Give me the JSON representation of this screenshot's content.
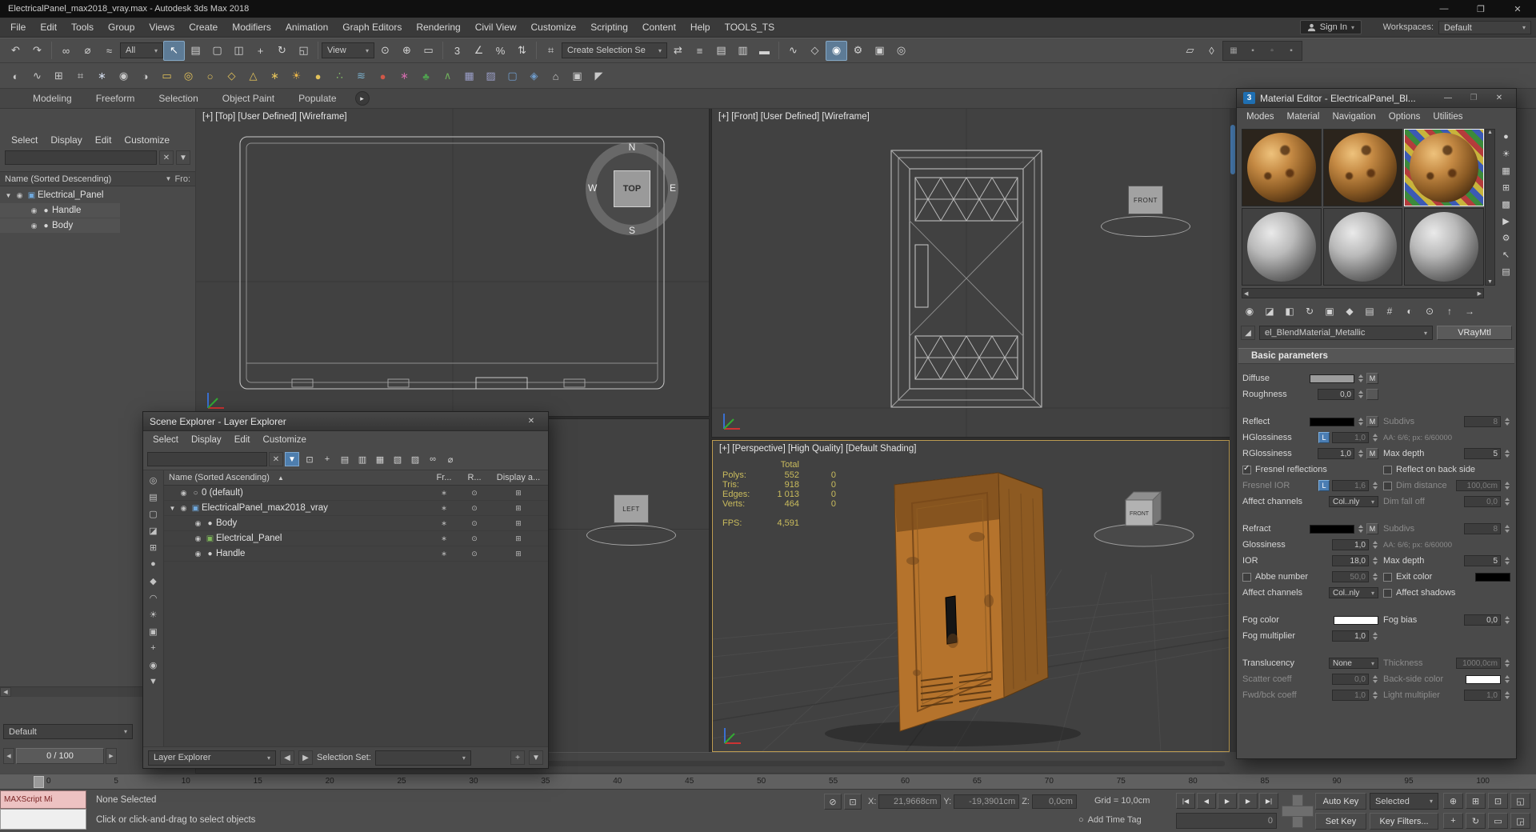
{
  "glyphs": {
    "minimize": "—",
    "maximize": "❐",
    "close": "✕",
    "clear": "✕",
    "funnel": "▼",
    "sort_asc": "▲",
    "left_arrow": "◀",
    "right_arrow": "▶",
    "up_arrow": "▲",
    "down_arrow": "▼",
    "app3": "3",
    "dropper": "◢",
    "ribbon_play": "▸",
    "play_start": "|◀",
    "play_prev": "◀",
    "play": "▶",
    "play_next": "▶",
    "play_end": "▶|",
    "isolate": "⊘",
    "lock": "⊡",
    "clock": "○"
  },
  "titlebar": {
    "title": "ElectricalPanel_max2018_vray.max - Autodesk 3ds Max 2018"
  },
  "menubar": {
    "items": [
      "File",
      "Edit",
      "Tools",
      "Group",
      "Views",
      "Create",
      "Modifiers",
      "Animation",
      "Graph Editors",
      "Rendering",
      "Civil View",
      "Customize",
      "Scripting",
      "Content",
      "Help",
      "TOOLS_TS"
    ],
    "sign_in": "Sign In",
    "workspaces_label": "Workspaces:",
    "workspace_value": "Default"
  },
  "toolbars": {
    "filter_value": "All",
    "ref_value": "View",
    "named_value": "Create Selection Se",
    "row1a": [
      {
        "name": "undo-icon",
        "glyph": "↶"
      },
      {
        "name": "redo-icon",
        "glyph": "↷"
      }
    ],
    "row1b": [
      {
        "name": "select-and-link-icon",
        "glyph": "∞"
      },
      {
        "name": "unlink-selection-icon",
        "glyph": "⌀"
      },
      {
        "name": "bind-to-space-warp-icon",
        "glyph": "≈"
      }
    ],
    "row1c": [
      {
        "name": "select-object-icon",
        "glyph": "↖",
        "cls": "active"
      },
      {
        "name": "select-by-name-icon",
        "glyph": "▤"
      },
      {
        "name": "rectangular-selection-region-icon",
        "glyph": "▢"
      },
      {
        "name": "window-crossing-icon",
        "glyph": "◫"
      }
    ],
    "row1d": [
      {
        "name": "select-and-move-icon",
        "glyph": "+"
      },
      {
        "name": "select-and-rotate-icon",
        "glyph": "↻"
      },
      {
        "name": "select-and-scale-icon",
        "glyph": "◱"
      }
    ],
    "row1e": [
      {
        "name": "use-pivot-point-icon",
        "glyph": "⊙"
      },
      {
        "name": "select-and-manipulate-icon",
        "glyph": "⊕"
      },
      {
        "name": "keyboard-shortcut-override-icon",
        "glyph": "▭"
      }
    ],
    "row1f": [
      {
        "name": "snaps-toggle-icon",
        "glyph": "3"
      },
      {
        "name": "angle-snap-icon",
        "glyph": "∠"
      },
      {
        "name": "percent-snap-icon",
        "glyph": "%"
      },
      {
        "name": "spinner-snap-icon",
        "glyph": "⇅"
      }
    ],
    "row1g": [
      {
        "name": "edit-named-selection-sets-icon",
        "glyph": "⌗"
      }
    ],
    "row1h": [
      {
        "name": "mirror-icon",
        "glyph": "⇄"
      },
      {
        "name": "align-icon",
        "glyph": "≡"
      },
      {
        "name": "toggle-scene-explorer-icon",
        "glyph": "▤"
      },
      {
        "name": "toggle-layer-explorer-icon",
        "glyph": "▥"
      },
      {
        "name": "toggle-ribbon-icon",
        "glyph": "▬"
      }
    ],
    "row1i": [
      {
        "name": "curve-editor-icon",
        "glyph": "∿"
      },
      {
        "name": "schematic-view-icon",
        "glyph": "◇"
      },
      {
        "name": "material-editor-icon",
        "glyph": "◉",
        "cls": "active"
      },
      {
        "name": "render-setup-icon",
        "glyph": "⚙"
      },
      {
        "name": "rendered-frame-window-icon",
        "glyph": "▣"
      },
      {
        "name": "render-production-icon",
        "glyph": "◎"
      }
    ],
    "row1_tail": [
      {
        "name": "project-folder-icon",
        "glyph": "▱"
      },
      {
        "name": "asset-tracking-icon",
        "glyph": "◊"
      }
    ],
    "row1_dark": [
      {
        "name": "viewport-layout-icon",
        "glyph": "▦"
      },
      {
        "name": "docking-left-icon",
        "glyph": "▪"
      },
      {
        "name": "docking-right-icon",
        "glyph": "▫"
      },
      {
        "name": "mini-listener-icon",
        "glyph": "▪"
      }
    ],
    "row2": [
      {
        "name": "freeform-paint-icon",
        "glyph": "◐",
        "color": "#c9c9c9"
      },
      {
        "name": "smudge-brush-icon",
        "glyph": "∿",
        "color": "#c9c9c9"
      },
      {
        "name": "grid-helper-icon",
        "glyph": "⊞",
        "color": "#c9c9c9"
      },
      {
        "name": "data-table-icon",
        "glyph": "⌗",
        "color": "#c9c9c9"
      },
      {
        "name": "snowflake-icon",
        "glyph": "∗",
        "color": "#cfd8e8"
      },
      {
        "name": "paint-deform-icon",
        "glyph": "◉",
        "color": "#c9c9c9"
      },
      {
        "name": "mirror-brush-icon",
        "glyph": "◑",
        "color": "#c9c9c9"
      },
      {
        "name": "rectangle-shape-icon",
        "glyph": "▭",
        "color": "#e3c25a"
      },
      {
        "name": "donut-shape-icon",
        "glyph": "◎",
        "color": "#e3c25a"
      },
      {
        "name": "circle-shape-icon",
        "glyph": "○",
        "color": "#e3c25a"
      },
      {
        "name": "ngon-shape-icon",
        "glyph": "◇",
        "color": "#e3c25a"
      },
      {
        "name": "cone-primitive-icon",
        "glyph": "△",
        "color": "#e3c25a"
      },
      {
        "name": "star-shape-icon",
        "glyph": "∗",
        "color": "#e3c25a"
      },
      {
        "name": "sun-light-icon",
        "glyph": "☀",
        "color": "#e8b44a"
      },
      {
        "name": "sphere-primitive-icon",
        "glyph": "●",
        "color": "#e3c25a"
      },
      {
        "name": "scatter-compound-icon",
        "glyph": "∴",
        "color": "#86c06a"
      },
      {
        "name": "spray-particles-icon",
        "glyph": "≋",
        "color": "#7ab0cc"
      },
      {
        "name": "fire-effect-icon",
        "glyph": "●",
        "color": "#d05848"
      },
      {
        "name": "flower-icon",
        "glyph": "∗",
        "color": "#cc6aa8"
      },
      {
        "name": "foliage-icon",
        "glyph": "♣",
        "color": "#4f9e4f"
      },
      {
        "name": "grass-icon",
        "glyph": "∧",
        "color": "#6fae5c"
      },
      {
        "name": "hold-icon",
        "glyph": "▦",
        "color": "#9a9ec8"
      },
      {
        "name": "fetch-icon",
        "glyph": "▨",
        "color": "#9a9ec8"
      },
      {
        "name": "container-icon",
        "glyph": "▢",
        "color": "#6f9ccc"
      },
      {
        "name": "compass-helper-icon",
        "glyph": "◈",
        "color": "#6f9ccc"
      },
      {
        "name": "walkthrough-icon",
        "glyph": "⌂",
        "color": "#c9c9c9"
      },
      {
        "name": "camera-create-icon",
        "glyph": "▣",
        "color": "#c9c9c9"
      },
      {
        "name": "populate-people-icon",
        "glyph": "◤",
        "color": "#c9c9c9"
      }
    ]
  },
  "ribbon": {
    "tabs": [
      "Modeling",
      "Freeform",
      "Selection",
      "Object Paint",
      "Populate"
    ]
  },
  "left_explorer": {
    "menus": [
      "Select",
      "Display",
      "Edit",
      "Customize"
    ],
    "header": "Name (Sorted Descending)",
    "header_right": "Fro:",
    "rows": [
      {
        "arrow": "▼",
        "icon": "▣",
        "icon_color": "#6fa8dc",
        "label": "Electrical_Panel",
        "level": 0
      },
      {
        "arrow": "",
        "icon": "●",
        "icon_color": "#d8d8d8",
        "label": "Handle",
        "level": 1
      },
      {
        "arrow": "",
        "icon": "●",
        "icon_color": "#d8d8d8",
        "label": "Body",
        "level": 1
      }
    ],
    "active_layer": "Default"
  },
  "viewports": {
    "top_label": "[+] [Top] [User Defined] [Wireframe]",
    "front_label": "[+] [Front] [User Defined] [Wireframe]",
    "persp_label": "[+] [Perspective] [High Quality] [Default Shading]",
    "viewcube": {
      "top": "TOP",
      "n": "N",
      "e": "E",
      "s": "S",
      "w": "W"
    },
    "front_helper": "FRONT",
    "left_helper": "LEFT",
    "persp_helper": "FRONT",
    "stats": {
      "total": "Total",
      "rows": [
        {
          "k": "Polys:",
          "v": "552",
          "v2": "0"
        },
        {
          "k": "Tris:",
          "v": "918",
          "v2": "0"
        },
        {
          "k": "Edges:",
          "v": "1 013",
          "v2": "0"
        },
        {
          "k": "Verts:",
          "v": "464",
          "v2": "0"
        }
      ],
      "fps_label": "FPS:",
      "fps": "4,591"
    }
  },
  "scene_explorer": {
    "title": "Scene Explorer - Layer Explorer",
    "menus": [
      "Select",
      "Display",
      "Edit",
      "Customize"
    ],
    "toolbar": [
      {
        "name": "se-lock-icon",
        "glyph": "⊡"
      },
      {
        "name": "se-pick-parent-icon",
        "glyph": "+"
      },
      {
        "name": "se-new-layer-icon",
        "glyph": "▤"
      },
      {
        "name": "se-add-to-layer-icon",
        "glyph": "▥"
      },
      {
        "name": "se-nested-layer-icon",
        "glyph": "▦"
      },
      {
        "name": "se-delete-layer-icon",
        "glyph": "▧"
      },
      {
        "name": "se-collapse-layers-icon",
        "glyph": "▨"
      },
      {
        "name": "se-link-icon",
        "glyph": "∞"
      },
      {
        "name": "se-unlink-icon",
        "glyph": "⌀"
      }
    ],
    "leftbar": [
      {
        "name": "se-find-icon",
        "glyph": "◎"
      },
      {
        "name": "se-select-all-icon",
        "glyph": "▤"
      },
      {
        "name": "se-select-none-icon",
        "glyph": "▢"
      },
      {
        "name": "se-select-invert-icon",
        "glyph": "◪"
      },
      {
        "name": "se-select-children-icon",
        "glyph": "⊞"
      },
      {
        "name": "se-show-all-icon",
        "glyph": "●"
      },
      {
        "name": "se-show-geometry-icon",
        "glyph": "◆"
      },
      {
        "name": "se-show-shapes-icon",
        "glyph": "◠"
      },
      {
        "name": "se-show-lights-icon",
        "glyph": "☀"
      },
      {
        "name": "se-show-cameras-icon",
        "glyph": "▣"
      },
      {
        "name": "se-show-helpers-icon",
        "glyph": "+"
      },
      {
        "name": "se-show-materials-icon",
        "glyph": "◉"
      },
      {
        "name": "se-pin-icon",
        "glyph": "▼"
      }
    ],
    "columns": [
      "Name (Sorted Ascending)",
      "Fr...",
      "R...",
      "Display a..."
    ],
    "rows": [
      {
        "arrow": "",
        "icon": "○",
        "icon_color": "#bdbdbd",
        "label": "0 (default)",
        "level": 0
      },
      {
        "arrow": "▼",
        "icon": "▣",
        "icon_color": "#6fa8dc",
        "label": "ElectricalPanel_max2018_vray",
        "level": 0
      },
      {
        "arrow": "",
        "icon": "●",
        "icon_color": "#d4d4d4",
        "label": "Body",
        "level": 1
      },
      {
        "arrow": "",
        "icon": "▣",
        "icon_color": "#7fb75a",
        "label": "Electrical_Panel",
        "level": 1
      },
      {
        "arrow": "",
        "icon": "●",
        "icon_color": "#d4d4d4",
        "label": "Handle",
        "level": 1
      }
    ],
    "footer": {
      "mode": "Layer Explorer",
      "selection_set_label": "Selection Set:"
    }
  },
  "material_editor": {
    "title": "Material Editor - ElectricalPanel_Bl...",
    "menus": [
      "Modes",
      "Material",
      "Navigation",
      "Options",
      "Utilities"
    ],
    "slots": [
      {
        "name": "sample-slot-1",
        "cls": "rust"
      },
      {
        "name": "sample-slot-2",
        "cls": "rust"
      },
      {
        "name": "sample-slot-3",
        "cls": "rust active"
      },
      {
        "name": "sample-slot-4",
        "cls": "gray"
      },
      {
        "name": "sample-slot-5",
        "cls": "gray"
      },
      {
        "name": "sample-slot-6",
        "cls": "gray"
      }
    ],
    "toolbar": [
      {
        "name": "get-material-icon",
        "glyph": "◉"
      },
      {
        "name": "put-to-scene-icon",
        "glyph": "◪"
      },
      {
        "name": "assign-to-selection-icon",
        "glyph": "◧"
      },
      {
        "name": "reset-map-icon",
        "glyph": "↻"
      },
      {
        "name": "make-copy-icon",
        "glyph": "▣"
      },
      {
        "name": "make-unique-icon",
        "glyph": "◆"
      },
      {
        "name": "put-to-library-icon",
        "glyph": "▤"
      },
      {
        "name": "material-id-icon",
        "glyph": "#"
      },
      {
        "name": "show-in-viewport-icon",
        "glyph": "◐"
      },
      {
        "name": "show-end-result-icon",
        "glyph": "⊙"
      },
      {
        "name": "go-to-parent-icon",
        "glyph": "↑"
      },
      {
        "name": "go-forward-icon",
        "glyph": "→"
      }
    ],
    "side_icons": [
      {
        "name": "sample-type-icon",
        "glyph": "●"
      },
      {
        "name": "backlight-icon",
        "glyph": "☀"
      },
      {
        "name": "background-icon",
        "glyph": "▦"
      },
      {
        "name": "uv-tiling-icon",
        "glyph": "⊞"
      },
      {
        "name": "video-color-check-icon",
        "glyph": "▩"
      },
      {
        "name": "make-preview-icon",
        "glyph": "▶"
      },
      {
        "name": "options-icon",
        "glyph": "⚙"
      },
      {
        "name": "select-by-material-icon",
        "glyph": "↖"
      },
      {
        "name": "material-navigator-icon",
        "glyph": "▤"
      }
    ],
    "material_name": "el_BlendMaterial_Metallic",
    "material_type": "VRayMtl",
    "rollout_title": "Basic parameters",
    "swatches": {
      "diffuse": "#9c9c9c",
      "reflect": "#000000",
      "refract": "#000000",
      "exit": "#000000",
      "fog": "#ffffff",
      "backside": "#ffffff"
    },
    "params": {
      "m": "M",
      "l": "L",
      "diffuse": "Diffuse",
      "roughness": "Roughness",
      "roughness_v": "0,0",
      "reflect": "Reflect",
      "subdivs": "Subdivs",
      "reflect_subdivs_v": "8",
      "hglossiness": "HGlossiness",
      "hglossiness_v": "1,0",
      "aa": "AA: 6/6; px: 6/60000",
      "rglossiness": "RGlossiness",
      "rglossiness_v": "1,0",
      "max_depth": "Max depth",
      "reflect_depth_v": "5",
      "fresnel": "Fresnel reflections",
      "back_side": "Reflect on back side",
      "fresnel_ior": "Fresnel IOR",
      "fresnel_ior_v": "1,6",
      "dim_distance": "Dim distance",
      "dim_distance_v": "100,0cm",
      "affect_channels": "Affect channels",
      "affect_channels_v": "Col..nly",
      "dim_fall_off": "Dim fall off",
      "dim_fall_off_v": "0,0",
      "refract": "Refract",
      "refract_subdivs_v": "8",
      "glossiness": "Glossiness",
      "glossiness_v": "1,0",
      "aa2": "AA: 6/6; px: 6/60000",
      "ior": "IOR",
      "ior_v": "18,0",
      "refract_depth_v": "5",
      "abbe": "Abbe number",
      "abbe_v": "50,0",
      "exit_color": "Exit color",
      "affect_channels2_v": "Col..nly",
      "affect_shadows": "Affect shadows",
      "fog_color": "Fog color",
      "fog_bias": "Fog bias",
      "fog_bias_v": "0,0",
      "fog_multiplier": "Fog multiplier",
      "fog_multiplier_v": "1,0",
      "translucency": "Translucency",
      "translucency_v": "None",
      "thickness": "Thickness",
      "thickness_v": "1000,0cm",
      "scatter": "Scatter coeff",
      "scatter_v": "0,0",
      "backside_color": "Back-side color",
      "fwdbck": "Fwd/bck coeff",
      "fwdbck_v": "1,0",
      "light_mult": "Light multiplier",
      "light_mult_v": "1,0"
    }
  },
  "timeline": {
    "slider_value": "0 / 100",
    "ticks": [
      "0",
      "5",
      "10",
      "15",
      "20",
      "25",
      "30",
      "35",
      "40",
      "45",
      "50",
      "55",
      "60",
      "65",
      "70",
      "75",
      "80",
      "85",
      "90",
      "95",
      "100"
    ]
  },
  "status": {
    "maxscript": "MAXScript Mi",
    "selection": "None Selected",
    "prompt": "Click or click-and-drag to select objects",
    "x_label": "X:",
    "x": "21,9668cm",
    "y_label": "Y:",
    "y": "-19,3901cm",
    "z_label": "Z:",
    "z": "0,0cm",
    "grid": "Grid = 10,0cm",
    "add_time_tag": "Add Time Tag",
    "frame": "0",
    "auto_key": "Auto Key",
    "set_key": "Set Key",
    "selected_dd": "Selected",
    "key_filters": "Key Filters..."
  }
}
